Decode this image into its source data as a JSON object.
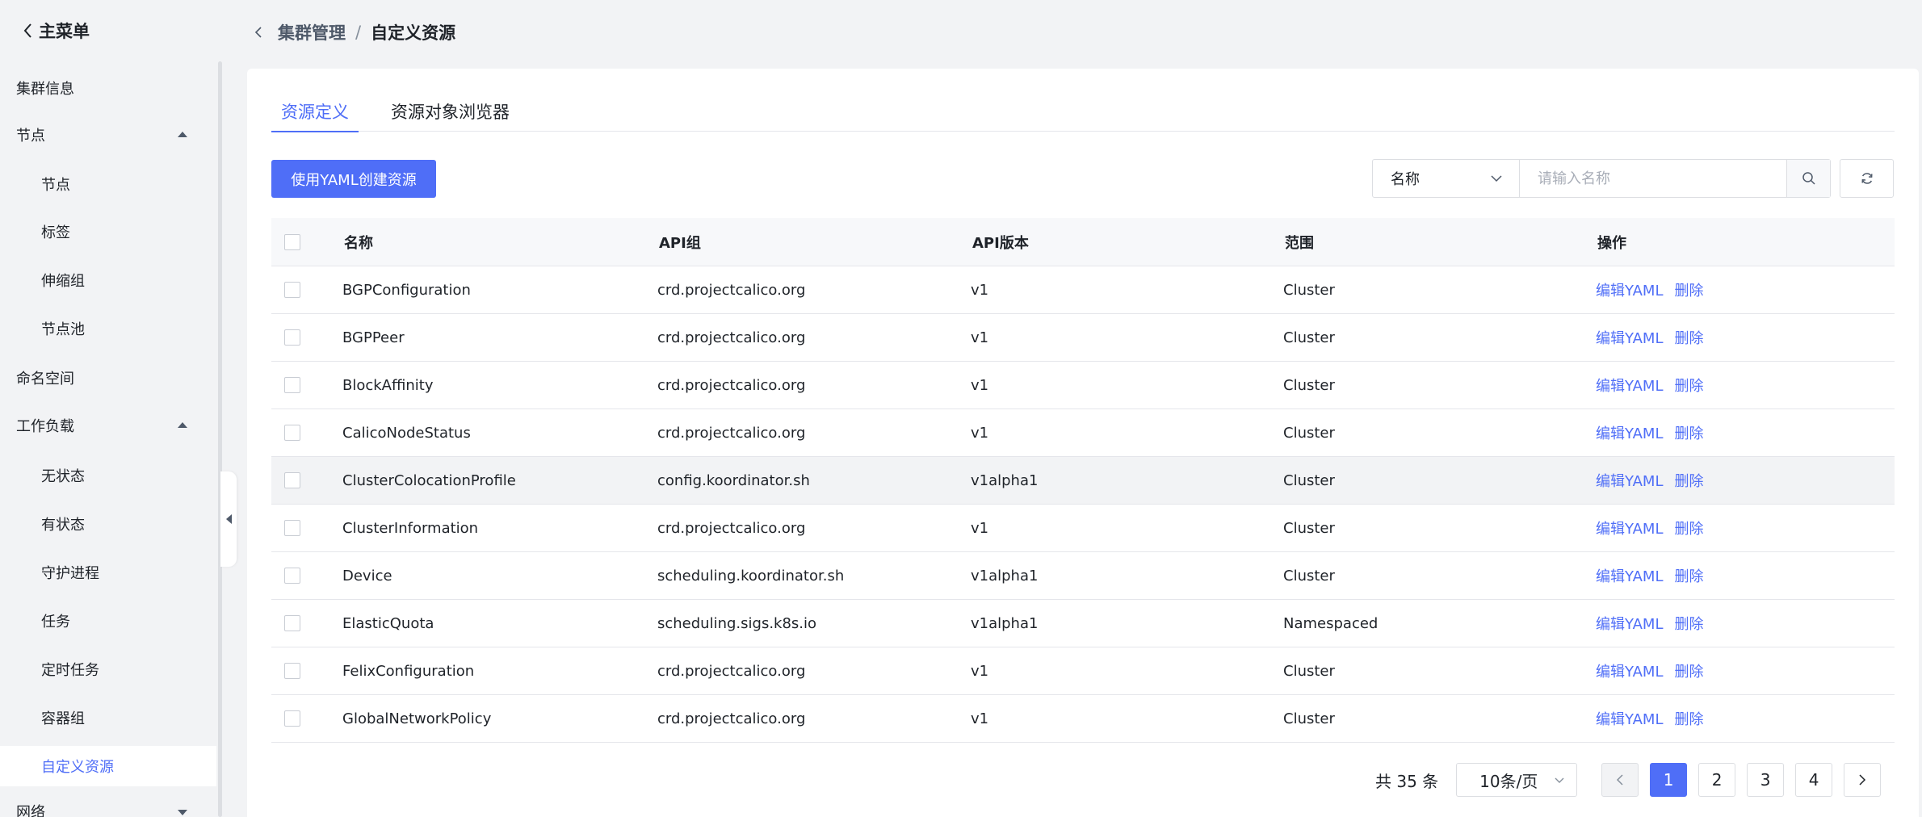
{
  "sidebar": {
    "main_menu": "主菜单",
    "items": [
      {
        "label": "集群信息"
      },
      {
        "label": "节点"
      },
      {
        "label": "节点"
      },
      {
        "label": "标签"
      },
      {
        "label": "伸缩组"
      },
      {
        "label": "节点池"
      },
      {
        "label": "命名空间"
      },
      {
        "label": "工作负载"
      },
      {
        "label": "无状态"
      },
      {
        "label": "有状态"
      },
      {
        "label": "守护进程"
      },
      {
        "label": "任务"
      },
      {
        "label": "定时任务"
      },
      {
        "label": "容器组"
      },
      {
        "label": "自定义资源"
      },
      {
        "label": "网络"
      }
    ]
  },
  "breadcrumb": {
    "parent": "集群管理",
    "separator": "/",
    "current": "自定义资源"
  },
  "tabs": [
    {
      "label": "资源定义",
      "active": true
    },
    {
      "label": "资源对象浏览器",
      "active": false
    }
  ],
  "toolbar": {
    "create_label": "使用YAML创建资源",
    "search_field": "名称",
    "search_placeholder": "请输入名称"
  },
  "table": {
    "headers": {
      "name": "名称",
      "group": "API组",
      "version": "API版本",
      "scope": "范围",
      "ops": "操作"
    },
    "op_edit": "编辑YAML",
    "op_delete": "删除",
    "rows": [
      {
        "name": "BGPConfiguration",
        "group": "crd.projectcalico.org",
        "version": "v1",
        "scope": "Cluster"
      },
      {
        "name": "BGPPeer",
        "group": "crd.projectcalico.org",
        "version": "v1",
        "scope": "Cluster"
      },
      {
        "name": "BlockAffinity",
        "group": "crd.projectcalico.org",
        "version": "v1",
        "scope": "Cluster"
      },
      {
        "name": "CalicoNodeStatus",
        "group": "crd.projectcalico.org",
        "version": "v1",
        "scope": "Cluster"
      },
      {
        "name": "ClusterColocationProfile",
        "group": "config.koordinator.sh",
        "version": "v1alpha1",
        "scope": "Cluster"
      },
      {
        "name": "ClusterInformation",
        "group": "crd.projectcalico.org",
        "version": "v1",
        "scope": "Cluster"
      },
      {
        "name": "Device",
        "group": "scheduling.koordinator.sh",
        "version": "v1alpha1",
        "scope": "Cluster"
      },
      {
        "name": "ElasticQuota",
        "group": "scheduling.sigs.k8s.io",
        "version": "v1alpha1",
        "scope": "Namespaced"
      },
      {
        "name": "FelixConfiguration",
        "group": "crd.projectcalico.org",
        "version": "v1",
        "scope": "Cluster"
      },
      {
        "name": "GlobalNetworkPolicy",
        "group": "crd.projectcalico.org",
        "version": "v1",
        "scope": "Cluster"
      }
    ]
  },
  "pagination": {
    "total": "共 35 条",
    "page_size": "10条/页",
    "pages": [
      "1",
      "2",
      "3",
      "4"
    ],
    "current_page": "1"
  },
  "colors": {
    "accent": "#4f6ef7",
    "background": "#f2f3f5",
    "text": "#1f2329"
  }
}
